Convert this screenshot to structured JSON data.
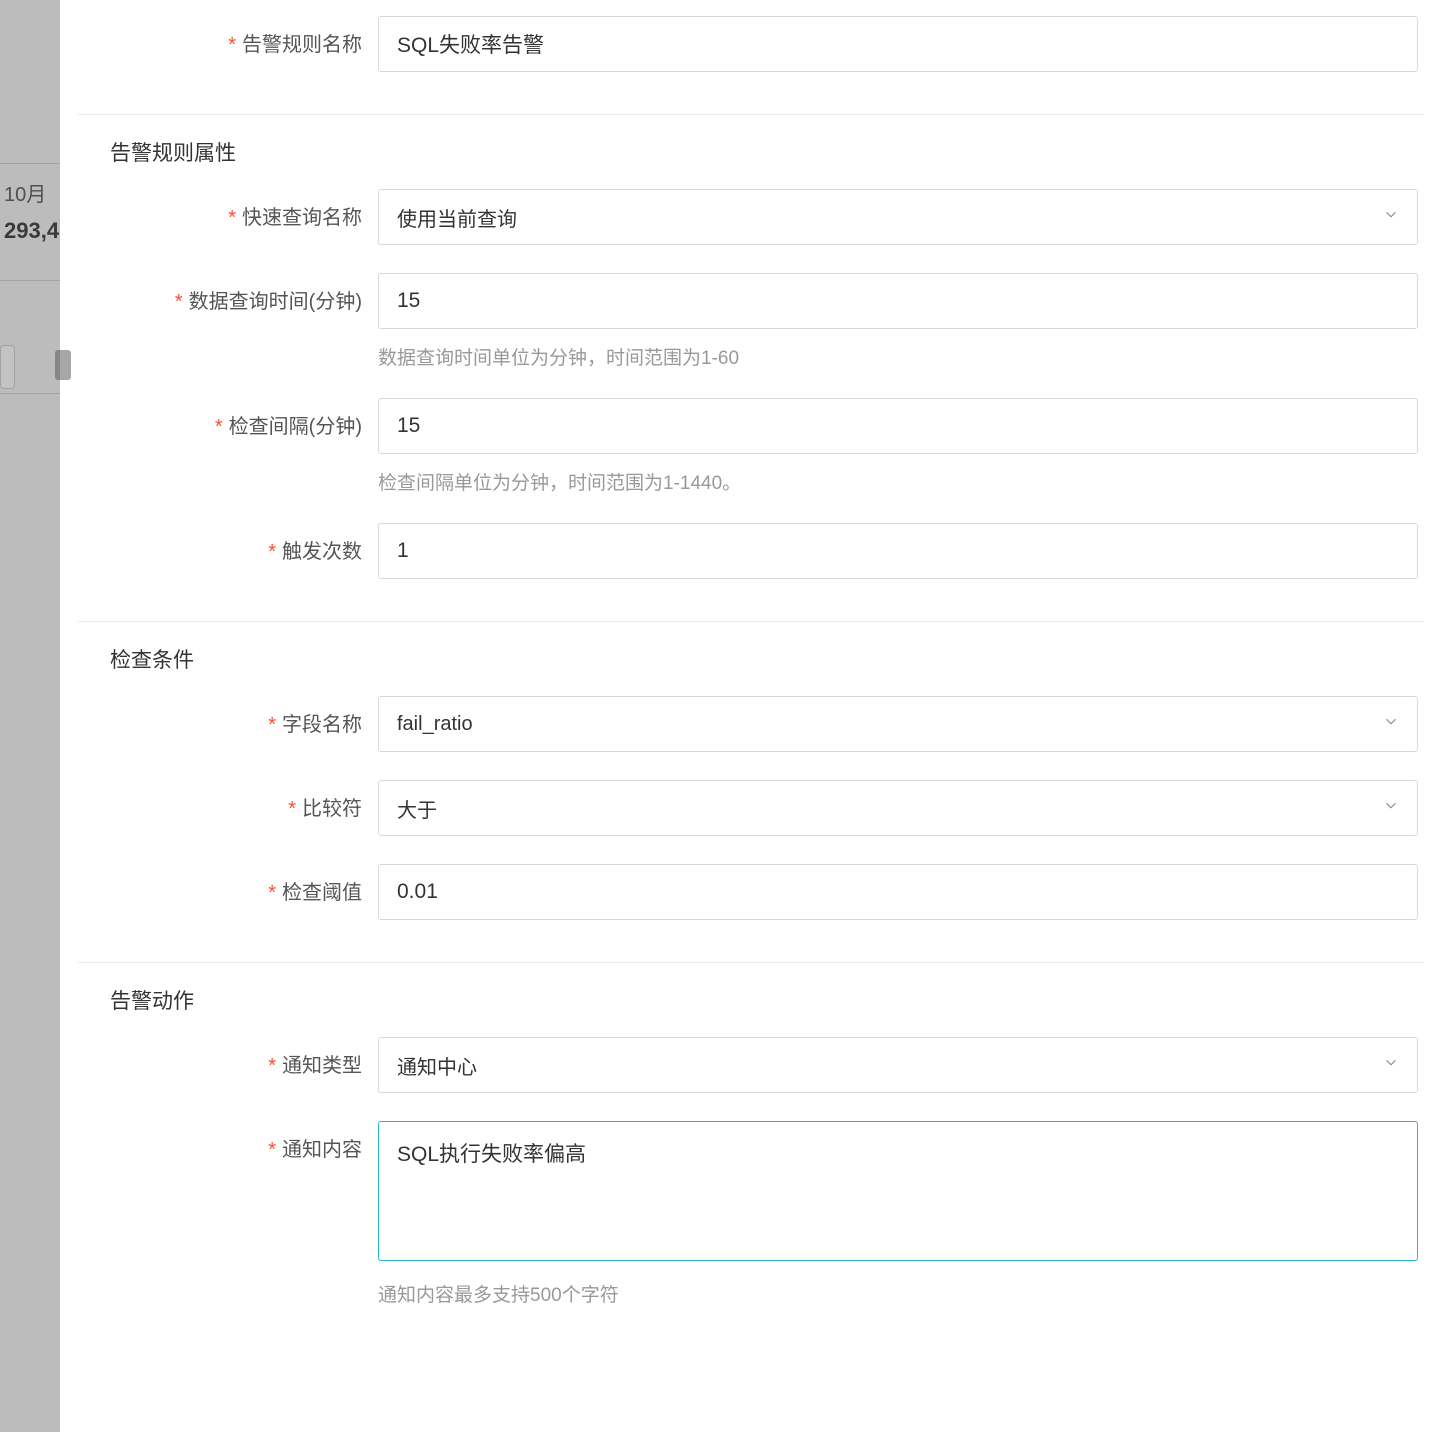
{
  "background": {
    "month_fragment": "10月",
    "number_fragment": "293,4"
  },
  "form": {
    "rule_name": {
      "label": "告警规则名称",
      "value": "SQL失败率告警"
    },
    "section_attrs": "告警规则属性",
    "quick_query": {
      "label": "快速查询名称",
      "value": "使用当前查询"
    },
    "query_time": {
      "label": "数据查询时间(分钟)",
      "value": "15",
      "help": "数据查询时间单位为分钟，时间范围为1-60"
    },
    "check_interval": {
      "label": "检查间隔(分钟)",
      "value": "15",
      "help": "检查间隔单位为分钟，时间范围为1-1440。"
    },
    "trigger_count": {
      "label": "触发次数",
      "value": "1"
    },
    "section_condition": "检查条件",
    "field_name": {
      "label": "字段名称",
      "value": "fail_ratio"
    },
    "comparator": {
      "label": "比较符",
      "value": "大于"
    },
    "threshold": {
      "label": "检查阈值",
      "value": "0.01"
    },
    "section_action": "告警动作",
    "notify_type": {
      "label": "通知类型",
      "value": "通知中心"
    },
    "notify_content": {
      "label": "通知内容",
      "value": "SQL执行失败率偏高",
      "help": "通知内容最多支持500个字符"
    }
  }
}
